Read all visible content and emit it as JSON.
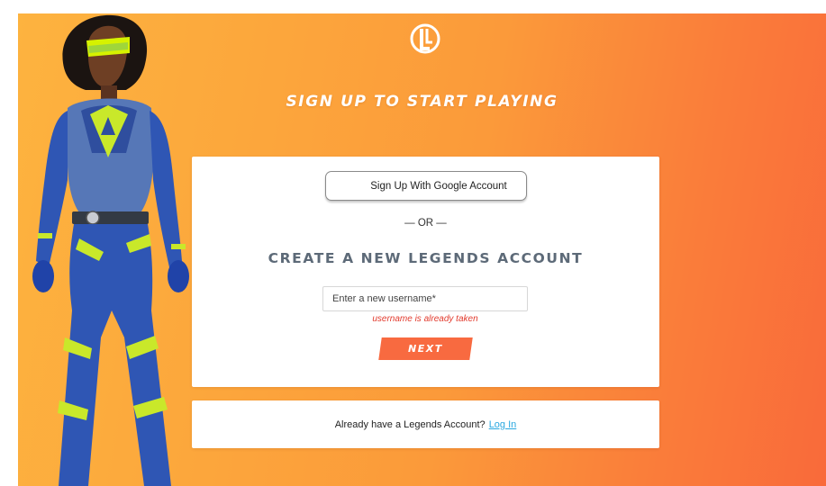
{
  "page": {
    "heading": "SIGN UP TO START PLAYING"
  },
  "signup": {
    "google_button_label": "Sign Up With Google Account",
    "or_divider": "— OR —",
    "create_heading": "CREATE A NEW LEGENDS ACCOUNT",
    "username_placeholder": "Enter a new username*",
    "username_error": "username is already taken",
    "next_label": "NEXT"
  },
  "login": {
    "prompt": "Already have a Legends Account?",
    "link_label": "Log In"
  },
  "icons": {
    "brand_logo": "legends-logo-icon",
    "google": "google-icon"
  },
  "colors": {
    "background_left": "#fdb33f",
    "background_right": "#f96a3a",
    "next_button": "#f86a40",
    "error_text": "#e23b2e",
    "link": "#2aa8e0",
    "heading_gray": "#5d6a78"
  }
}
